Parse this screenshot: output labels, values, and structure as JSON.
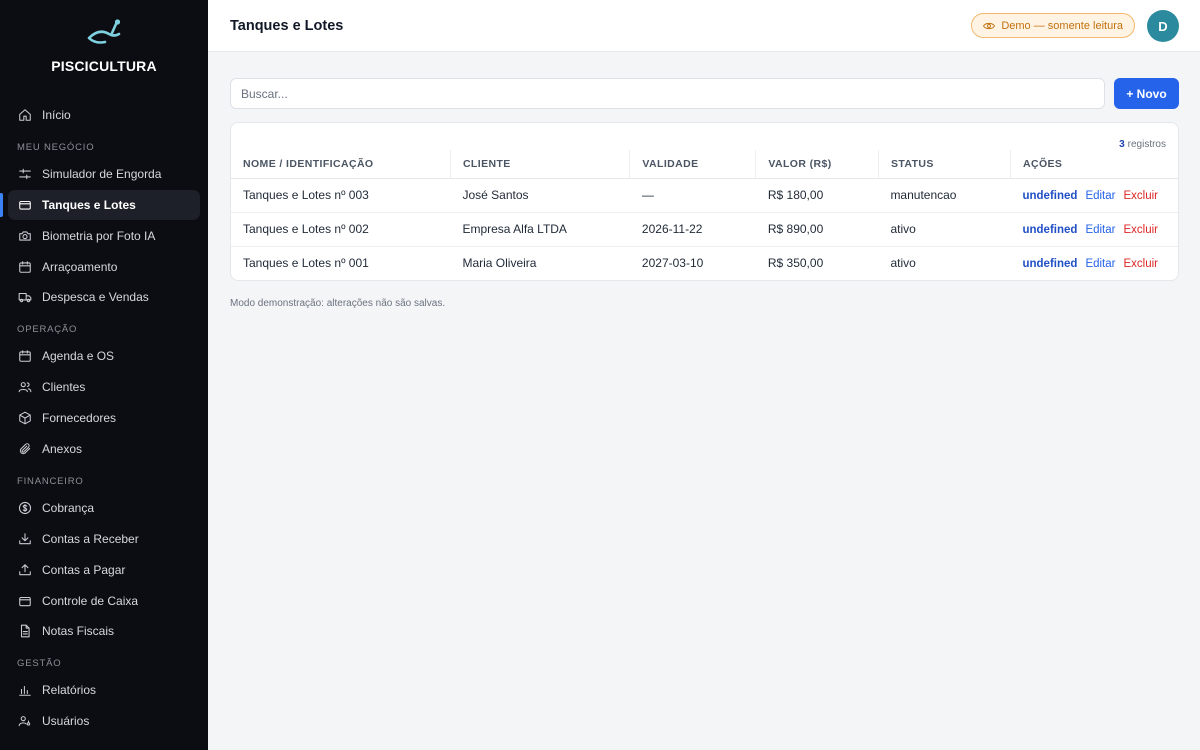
{
  "brand": {
    "name": "PISCICULTURA",
    "accent": "#7fd1e0"
  },
  "header": {
    "title": "Tanques e Lotes",
    "demo_badge": "Demo — somente leitura",
    "avatar_initial": "D"
  },
  "sidebar": {
    "home": "Início",
    "sections": {
      "negocio": "MEU NEGÓCIO",
      "operacao": "OPERAÇÃO",
      "financeiro": "FINANCEIRO",
      "gestao": "GESTÃO"
    },
    "items": {
      "simulador": "Simulador de Engorda",
      "tanques": "Tanques e Lotes",
      "biometria": "Biometria por Foto IA",
      "arracoamento": "Arraçoamento",
      "despesca": "Despesca e Vendas",
      "agenda": "Agenda e OS",
      "clientes": "Clientes",
      "fornecedores": "Fornecedores",
      "anexos": "Anexos",
      "cobranca": "Cobrança",
      "receber": "Contas a Receber",
      "pagar": "Contas a Pagar",
      "caixa": "Controle de Caixa",
      "notas": "Notas Fiscais",
      "relatorios": "Relatórios",
      "usuarios": "Usuários"
    }
  },
  "search": {
    "placeholder": "Buscar..."
  },
  "new_button": "+ Novo",
  "table": {
    "count": "3",
    "count_label": "registros",
    "columns": [
      "NOME / IDENTIFICAÇÃO",
      "CLIENTE",
      "VALIDADE",
      "VALOR (R$)",
      "STATUS",
      "AÇÕES"
    ],
    "rows": [
      {
        "nome": "Tanques e Lotes nº 003",
        "cliente": "José Santos",
        "validade": "—",
        "valor": "R$ 180,00",
        "status": "manutencao"
      },
      {
        "nome": "Tanques e Lotes nº 002",
        "cliente": "Empresa Alfa LTDA",
        "validade": "2026-11-22",
        "valor": "R$ 890,00",
        "status": "ativo"
      },
      {
        "nome": "Tanques e Lotes nº 001",
        "cliente": "Maria Oliveira",
        "validade": "2027-03-10",
        "valor": "R$ 350,00",
        "status": "ativo"
      }
    ],
    "actions": {
      "view": "undefined",
      "edit": "Editar",
      "delete": "Excluir"
    }
  },
  "footnote": "Modo demonstração: alterações não são salvas."
}
